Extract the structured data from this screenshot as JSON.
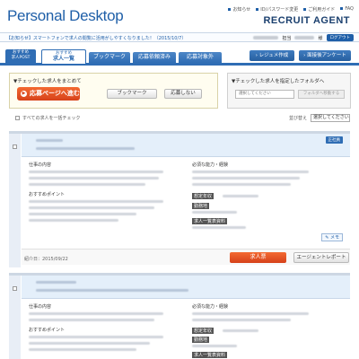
{
  "header": {
    "logo": "Personal Desktop",
    "brand": "RECRUIT AGENT",
    "links": [
      "お知らせ",
      "ID/パスワード変更",
      "ご利用ガイド",
      "FAQ"
    ]
  },
  "notice": {
    "text": "【お知らせ】スマートフォンで求人の閲覧に活用がしやすくなりました！（2015/10/7）",
    "suffix": "様",
    "logout": "ログアウト"
  },
  "nav": {
    "post_line1": "おすすめ",
    "post_line2": "求人POST",
    "tabs": [
      {
        "small": "おすすめ",
        "label": "求人一覧"
      },
      {
        "label": "ブックマーク"
      },
      {
        "label": "応募依頼済み"
      },
      {
        "label": "応募対象外"
      }
    ],
    "right_buttons": [
      "レジュメ作成",
      "面接後アンケート"
    ]
  },
  "bulk": {
    "title": "▼チェックした求人をまとめて",
    "apply": "応募ページへ進む",
    "apply_icon": "▶",
    "bookmark": "ブックマーク",
    "decline": "応募しない"
  },
  "folder": {
    "title": "▼チェックした求人を指定したフォルダへ",
    "select_placeholder": "選択してください",
    "move": "フォルダへ移動する"
  },
  "list": {
    "check_all": "すべての求人を一括チェック",
    "sort_label": "並び替え",
    "sort_value": "選択してください"
  },
  "cards": [
    {
      "badge": "正社員",
      "labels": {
        "job": "仕事の内容",
        "point": "おすすめポイント",
        "skill": "必須な能力・経験",
        "age": "想定年収",
        "location": "勤務地",
        "detail": "求人一覧表資料"
      },
      "memo": "メモ",
      "date": "紹介日：2015/09/22",
      "ticket": "求人票",
      "report": "エージェントレポート"
    },
    {
      "labels": {
        "job": "仕事の内容",
        "point": "おすすめポイント",
        "skill": "必須な能力・経験",
        "age": "想定年収",
        "location": "勤務地",
        "detail": "求人一覧表資料"
      }
    }
  ],
  "colors": {
    "accent": "#2f6db4",
    "apply": "#e3522a",
    "logo": "#1f5fa8"
  }
}
